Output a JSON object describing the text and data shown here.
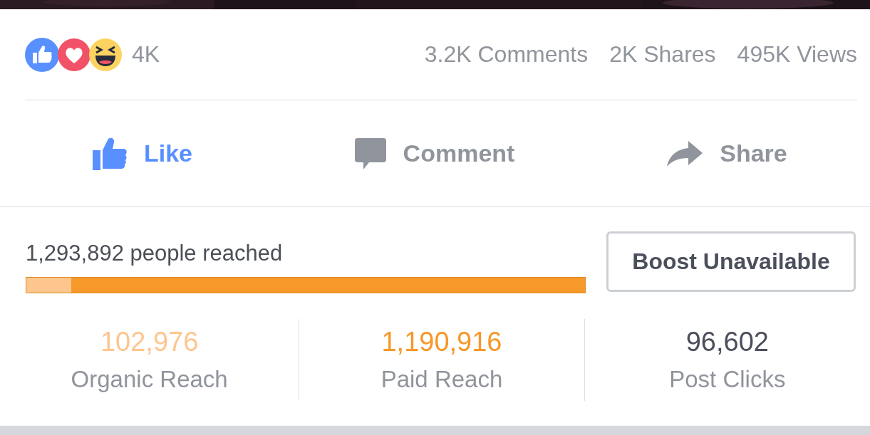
{
  "reactions": {
    "count": "4K",
    "stats": [
      "3.2K Comments",
      "2K Shares",
      "495K Views"
    ]
  },
  "actions": [
    {
      "label": "Like",
      "kind": "like",
      "selected": true
    },
    {
      "label": "Comment",
      "kind": "comment",
      "selected": false
    },
    {
      "label": "Share",
      "kind": "share",
      "selected": false
    }
  ],
  "reach": {
    "summary": "1,293,892 people reached",
    "bar": {
      "level": 0.08
    },
    "boost_button": "Boost Unavailable"
  },
  "metrics": [
    {
      "value": "102,976",
      "label": "Organic Reach",
      "color": "#fdc68f"
    },
    {
      "value": "1,190,916",
      "label": "Paid Reach",
      "color": "#f7982a"
    },
    {
      "value": "96,602",
      "label": "Post Clicks",
      "color": "#4b4f5c"
    }
  ]
}
